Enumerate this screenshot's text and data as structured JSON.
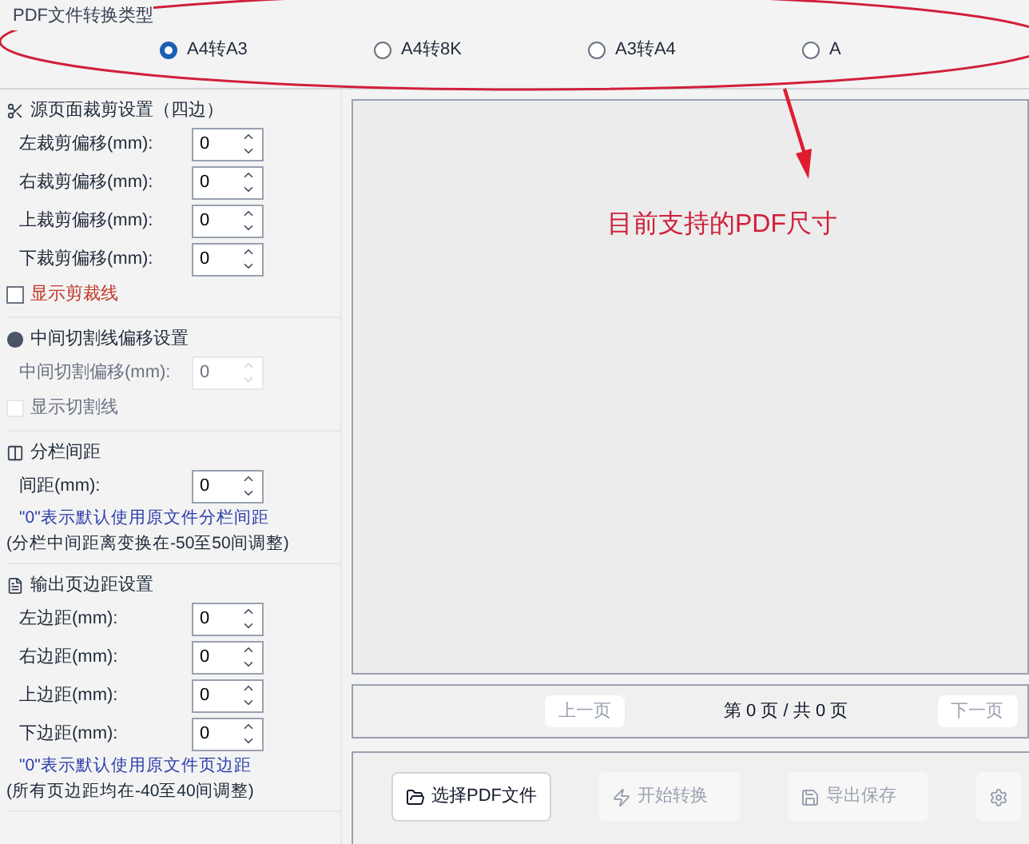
{
  "conversion_type": {
    "title": "PDF文件转换类型",
    "options": [
      {
        "label": "A4转A3",
        "selected": true
      },
      {
        "label": "A4转8K",
        "selected": false
      },
      {
        "label": "A3转A4",
        "selected": false
      },
      {
        "label": "A",
        "selected": false
      }
    ]
  },
  "sections": [
    {
      "kind": "crop",
      "title": "源页面裁剪设置（四边）",
      "fields": [
        {
          "label": "左裁剪偏移(mm):",
          "value": "0",
          "disabled": false
        },
        {
          "label": "右裁剪偏移(mm):",
          "value": "0",
          "disabled": false
        },
        {
          "label": "上裁剪偏移(mm):",
          "value": "0",
          "disabled": false
        },
        {
          "label": "下裁剪偏移(mm):",
          "value": "0",
          "disabled": false
        }
      ],
      "checkbox": {
        "label": "显示剪裁线",
        "checked": false,
        "disabled": false
      }
    },
    {
      "kind": "middle",
      "title": "中间切割线偏移设置",
      "fields": [
        {
          "label": "中间切割偏移(mm):",
          "value": "0",
          "disabled": true
        }
      ],
      "checkbox": {
        "label": "显示切割线",
        "checked": false,
        "disabled": true
      }
    },
    {
      "kind": "column",
      "title": "分栏间距",
      "fields": [
        {
          "label": "间距(mm):",
          "value": "0",
          "disabled": false
        }
      ],
      "notes": [
        {
          "kind": "hint",
          "text": "\"0\"表示默认使用原文件分栏间距"
        },
        {
          "kind": "range",
          "text": "(分栏中间距离变换在-50至50间调整)"
        }
      ]
    },
    {
      "kind": "margin",
      "title": "输出页边距设置",
      "fields": [
        {
          "label": "左边距(mm):",
          "value": "0",
          "disabled": false
        },
        {
          "label": "右边距(mm):",
          "value": "0",
          "disabled": false
        },
        {
          "label": "上边距(mm):",
          "value": "0",
          "disabled": false
        },
        {
          "label": "下边距(mm):",
          "value": "0",
          "disabled": false
        }
      ],
      "notes": [
        {
          "kind": "hint",
          "text": "\"0\"表示默认使用原文件页边距"
        },
        {
          "kind": "range",
          "text": "(所有页边距均在-40至40间调整)"
        }
      ]
    }
  ],
  "annotation": {
    "text": "目前支持的PDF尺寸"
  },
  "pager": {
    "prev": {
      "label": "上一页",
      "disabled": true
    },
    "status": "第 0 页 / 共 0 页",
    "next": {
      "label": "下一页",
      "disabled": true
    }
  },
  "actions": [
    {
      "kind": "open",
      "label": "选择PDF文件",
      "disabled": false
    },
    {
      "kind": "convert",
      "label": "开始转换",
      "disabled": true
    },
    {
      "kind": "save",
      "label": "导出保存",
      "disabled": true
    },
    {
      "kind": "settings",
      "disabled": true
    }
  ]
}
